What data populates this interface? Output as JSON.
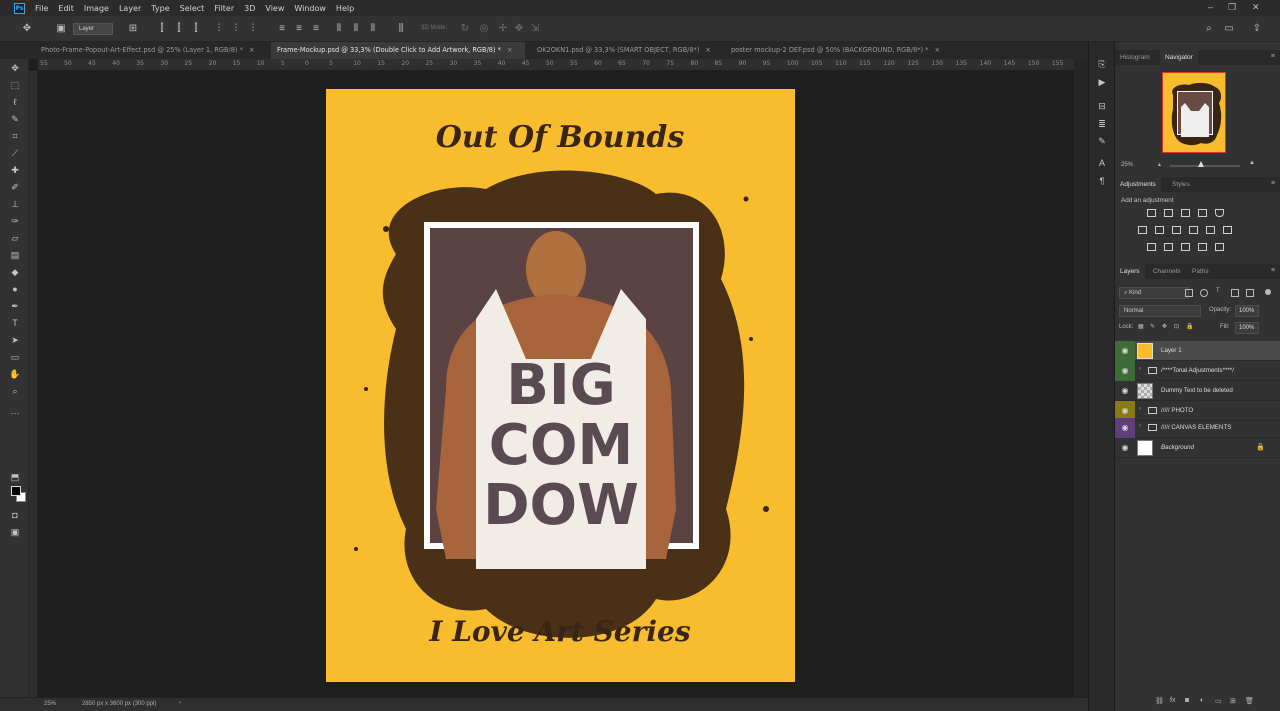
{
  "menubar": {
    "app_badge": "Ps",
    "items": [
      "File",
      "Edit",
      "Image",
      "Layer",
      "Type",
      "Select",
      "Filter",
      "3D",
      "View",
      "Window",
      "Help"
    ]
  },
  "options_bar": {
    "auto_select_value": "Layer",
    "mode_label": "3D Mode:"
  },
  "tabs": [
    {
      "title": "Photo-Frame-Popout-Art-Effect.psd @ 25% (Layer 1, RGB/8) *",
      "active": false
    },
    {
      "title": "Frame-Mockup.psd @ 33,3% (Double Click to Add Artwork, RGB/8) *",
      "active": true
    },
    {
      "title": "OK2OKN1.psd @ 33,3% (SMART OBJECT, RGB/8*)",
      "active": false
    },
    {
      "title": "poster mockup-2 DEF.psd @ 50% (BACKGROUND, RGB/8*) *",
      "active": false
    }
  ],
  "ruler": {
    "ticks": [
      "55",
      "50",
      "45",
      "40",
      "35",
      "30",
      "25",
      "20",
      "15",
      "10",
      "5",
      "0",
      "5",
      "10",
      "15",
      "20",
      "25",
      "30",
      "35",
      "40",
      "45",
      "50",
      "55",
      "60",
      "65",
      "70",
      "75",
      "80",
      "85",
      "90",
      "95",
      "100",
      "105",
      "110",
      "115",
      "120",
      "125",
      "130",
      "135",
      "140",
      "145",
      "150",
      "155"
    ]
  },
  "artwork": {
    "title": "Out Of Bounds",
    "footer": "I Love Art Series",
    "shirt_lines": [
      "BIG",
      "COM",
      "DOW"
    ],
    "colors": {
      "background": "#f7bd2e",
      "ink": "#3a2416",
      "frame": "#ffffff"
    }
  },
  "status": {
    "zoom": "25%",
    "doc_info": "2850 px x 3600 px (300 ppi)"
  },
  "navigator": {
    "tabs": [
      "Histogram",
      "Navigator"
    ],
    "active_tab": "Navigator",
    "zoom": "25%"
  },
  "adjustments": {
    "tabs": [
      "Adjustments",
      "Styles"
    ],
    "active_tab": "Adjustments",
    "hint": "Add an adjustment"
  },
  "layers_panel": {
    "tabs": [
      "Layers",
      "Channels",
      "Paths"
    ],
    "active_tab": "Layers",
    "filter_kind": "Kind",
    "blend_mode": "Normal",
    "opacity_label": "Opacity:",
    "opacity": "100%",
    "lock_label": "Lock:",
    "fill_label": "Fill:",
    "fill": "100%",
    "layers": [
      {
        "name": "Layer 1",
        "type": "pixel",
        "selected": true,
        "vis_color": "#3f6b3a",
        "thumb": "art"
      },
      {
        "name": "/****Tonal Adjustments****/",
        "type": "group",
        "selected": false,
        "vis_color": "#3f6b3a"
      },
      {
        "name": "Dummy Text to be deleted",
        "type": "pixel",
        "selected": false,
        "vis_color": "",
        "thumb": "checker"
      },
      {
        "name": "///// PHOTO",
        "type": "group",
        "selected": false,
        "vis_color": "#8a7a16"
      },
      {
        "name": "///// CANVAS ELEMENTS",
        "type": "group",
        "selected": false,
        "vis_color": "#5e3f7a"
      },
      {
        "name": "Background",
        "type": "pixel",
        "selected": false,
        "vis_color": "",
        "thumb": "white",
        "locked": true
      }
    ]
  }
}
